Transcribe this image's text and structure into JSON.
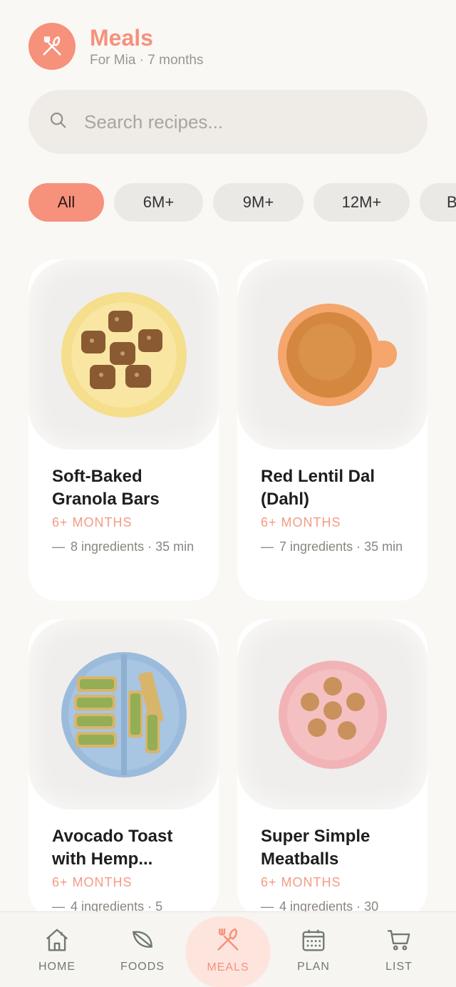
{
  "header": {
    "title": "Meals",
    "subtitle": "For Mia · 7 months",
    "logo_icon": "utensils-icon"
  },
  "search": {
    "placeholder": "Search recipes...",
    "value": "",
    "icon": "search-icon"
  },
  "filters": [
    {
      "label": "All",
      "active": true
    },
    {
      "label": "6M+",
      "active": false
    },
    {
      "label": "9M+",
      "active": false
    },
    {
      "label": "12M+",
      "active": false
    },
    {
      "label": "B",
      "active": false
    }
  ],
  "recipes": [
    {
      "name": "Soft-Baked Granola Bars",
      "age": "6+ MONTHS",
      "meta": "8 ingredients · 35 min",
      "plate_color": "#f5de8c"
    },
    {
      "name": "Red Lentil Dal (Dahl)",
      "age": "6+ MONTHS",
      "meta": "7 ingredients · 35 min",
      "plate_color": "#f4a66c"
    },
    {
      "name": "Avocado Toast with Hemp...",
      "age": "6+ MONTHS",
      "meta": "4 ingredients · 5",
      "plate_color": "#9bbbdc"
    },
    {
      "name": "Super Simple Meatballs",
      "age": "6+ MONTHS",
      "meta": "4 ingredients · 30",
      "plate_color": "#f2b3b6"
    }
  ],
  "tabs": [
    {
      "label": "HOME",
      "icon": "home-icon"
    },
    {
      "label": "FOODS",
      "icon": "leaf-icon"
    },
    {
      "label": "MEALS",
      "icon": "utensils-icon",
      "active": true
    },
    {
      "label": "PLAN",
      "icon": "calendar-icon"
    },
    {
      "label": "LIST",
      "icon": "cart-icon"
    }
  ],
  "colors": {
    "accent": "#f6917b",
    "background": "#faf8f5",
    "tab_inactive": "#6f7a73"
  }
}
